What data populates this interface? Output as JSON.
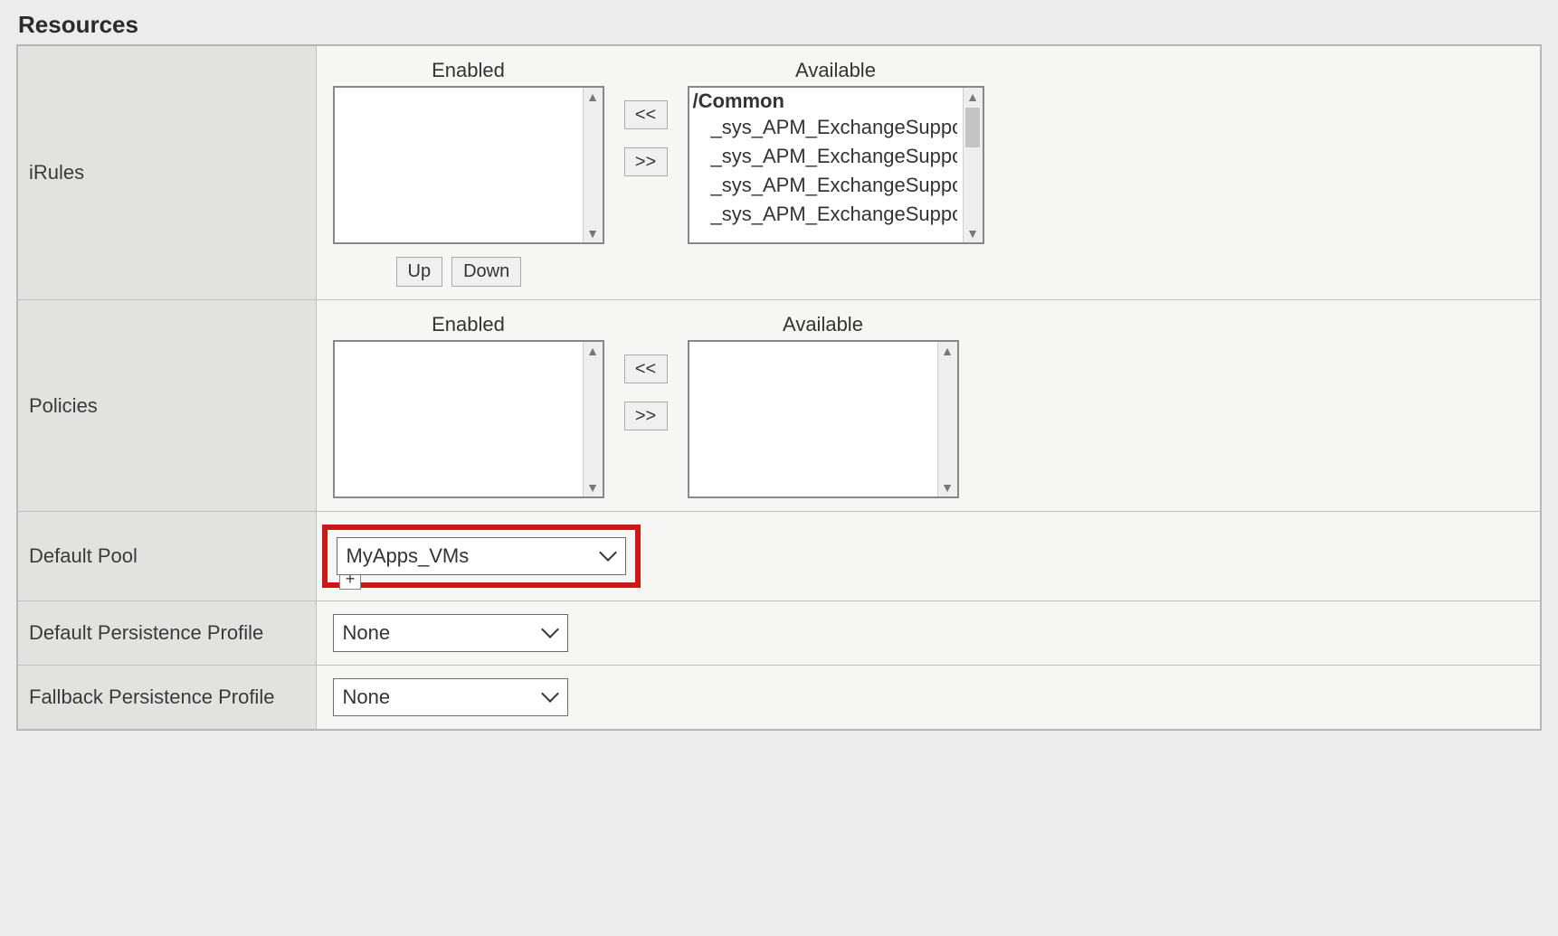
{
  "section_title": "Resources",
  "irules": {
    "label": "iRules",
    "enabled_label": "Enabled",
    "available_label": "Available",
    "enabled_items": [],
    "available_group": "/Common",
    "available_items": [
      "_sys_APM_ExchangeSupport_OA",
      "_sys_APM_ExchangeSupport_OA",
      "_sys_APM_ExchangeSupport_he",
      "_sys_APM_ExchangeSupport_ma"
    ],
    "move_left": "<<",
    "move_right": ">>",
    "up_label": "Up",
    "down_label": "Down"
  },
  "policies": {
    "label": "Policies",
    "enabled_label": "Enabled",
    "available_label": "Available",
    "enabled_items": [],
    "available_items": [],
    "move_left": "<<",
    "move_right": ">>"
  },
  "default_pool": {
    "label": "Default Pool",
    "plus": "+",
    "value": "MyApps_VMs"
  },
  "default_persistence": {
    "label": "Default Persistence Profile",
    "value": "None"
  },
  "fallback_persistence": {
    "label": "Fallback Persistence Profile",
    "value": "None"
  }
}
